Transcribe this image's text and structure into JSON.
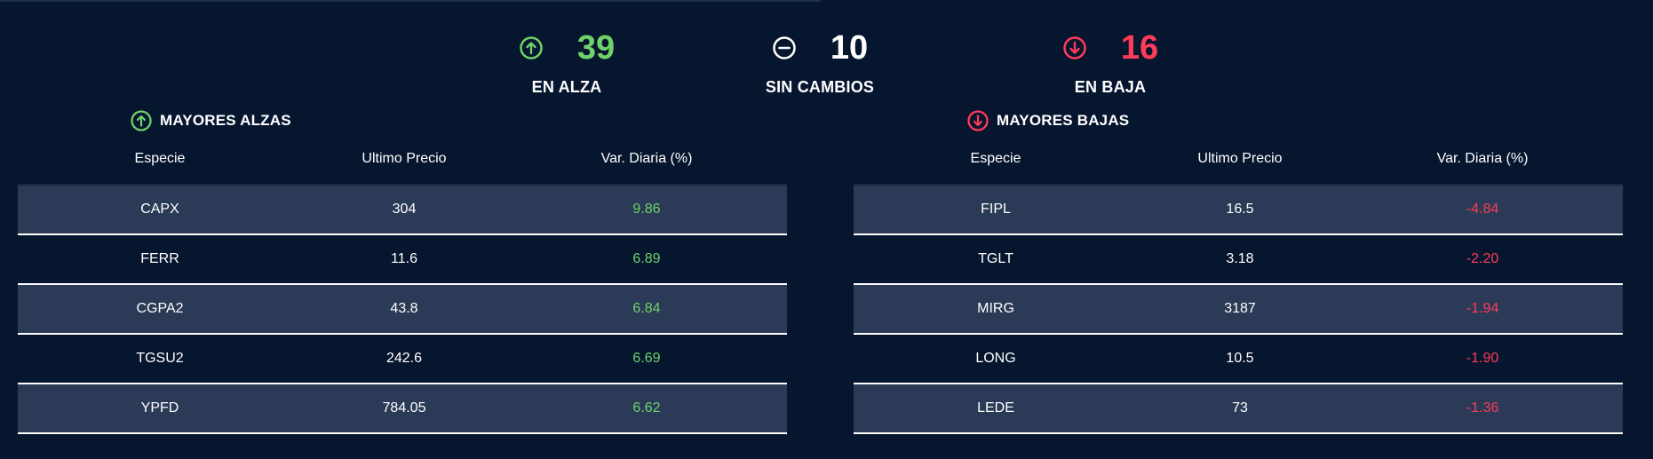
{
  "summary": {
    "up": {
      "value": "39",
      "label": "EN ALZA",
      "icon": "arrow-up-circle-icon",
      "color": "#6fd26a"
    },
    "unchanged": {
      "value": "10",
      "label": "SIN CAMBIOS",
      "icon": "minus-circle-icon",
      "color": "#ffffff"
    },
    "down": {
      "value": "16",
      "label": "EN BAJA",
      "icon": "arrow-down-circle-icon",
      "color": "#ff3b57"
    }
  },
  "gainers": {
    "title": "MAYORES ALZAS",
    "headers": [
      "Especie",
      "Ultimo Precio",
      "Var. Diaria (%)"
    ],
    "rows": [
      {
        "especie": "CAPX",
        "precio": "304",
        "variacion": "9.86"
      },
      {
        "especie": "FERR",
        "precio": "11.6",
        "variacion": "6.89"
      },
      {
        "especie": "CGPA2",
        "precio": "43.8",
        "variacion": "6.84"
      },
      {
        "especie": "TGSU2",
        "precio": "242.6",
        "variacion": "6.69"
      },
      {
        "especie": "YPFD",
        "precio": "784.05",
        "variacion": "6.62"
      }
    ]
  },
  "losers": {
    "title": "MAYORES BAJAS",
    "headers": [
      "Especie",
      "Ultimo Precio",
      "Var. Diaria (%)"
    ],
    "rows": [
      {
        "especie": "FIPL",
        "precio": "16.5",
        "variacion": "-4.84"
      },
      {
        "especie": "TGLT",
        "precio": "3.18",
        "variacion": "-2.20"
      },
      {
        "especie": "MIRG",
        "precio": "3187",
        "variacion": "-1.94"
      },
      {
        "especie": "LONG",
        "precio": "10.5",
        "variacion": "-1.90"
      },
      {
        "especie": "LEDE",
        "precio": "73",
        "variacion": "-1.36"
      }
    ]
  },
  "colors": {
    "background": "#07162f",
    "row_shade": "#2b3a56",
    "positive": "#6fd26a",
    "negative": "#ff3b57"
  }
}
